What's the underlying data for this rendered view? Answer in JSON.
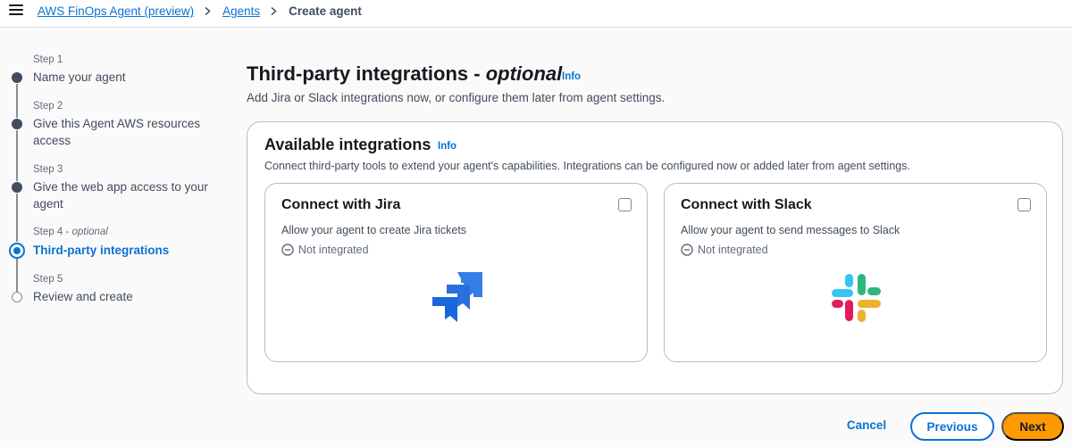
{
  "breadcrumbs": {
    "items": [
      {
        "label": "AWS FinOps Agent (preview)"
      },
      {
        "label": "Agents"
      }
    ],
    "current": "Create agent"
  },
  "steps": [
    {
      "number": "Step 1",
      "name": "Name your agent",
      "state": "complete"
    },
    {
      "number": "Step 2",
      "name": "Give this Agent AWS resources access",
      "state": "complete"
    },
    {
      "number": "Step 3",
      "name": "Give the web app access to your agent",
      "state": "complete"
    },
    {
      "number": "Step 4",
      "optional": "optional",
      "name": "Third-party integrations",
      "state": "active"
    },
    {
      "number": "Step 5",
      "name": "Review and create",
      "state": "future"
    }
  ],
  "page": {
    "title": "Third-party integrations - ",
    "title_optional": "optional",
    "info": "Info",
    "description": "Add Jira or Slack integrations now, or configure them later from agent settings."
  },
  "integrations": {
    "title": "Available integrations",
    "info": "Info",
    "description": "Connect third-party tools to extend your agent's capabilities. Integrations can be configured now or added later from agent settings.",
    "cards": [
      {
        "title": "Connect with Jira",
        "description": "Allow your agent to create Jira tickets",
        "status": "Not integrated",
        "logo": "jira-logo",
        "checked": false
      },
      {
        "title": "Connect with Slack",
        "description": "Allow your agent to send messages to Slack",
        "status": "Not integrated",
        "logo": "slack-logo",
        "checked": false
      }
    ]
  },
  "footer": {
    "cancel": "Cancel",
    "previous": "Previous",
    "next": "Next"
  },
  "colors": {
    "link": "#0972d3",
    "primary_button": "#ff9900",
    "active_step": "#0972d3",
    "jira_dark": "#1868db",
    "jira_light": "#357de8",
    "slack_blue": "#36c5f0",
    "slack_green": "#2eb67d",
    "slack_red": "#e01e5a",
    "slack_yellow": "#ecb22e"
  }
}
